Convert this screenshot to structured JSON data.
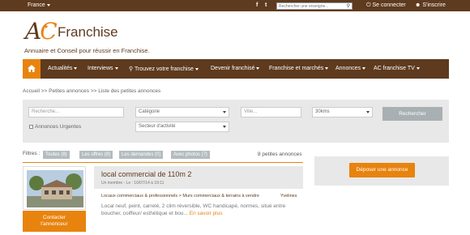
{
  "topbar": {
    "country": "France",
    "facebook_icon_label": "f",
    "twitter_icon_label": "t",
    "search_placeholder": "Rechercher une enseigne...",
    "login_label": "Se connecter",
    "register_label": "S'inscrire"
  },
  "brand": {
    "logo_ac_a": "A",
    "logo_ac_c": "C",
    "logo_text": "Franchise",
    "tagline": "Annuaire et Conseil pour réussir en Franchise."
  },
  "nav": {
    "items": [
      "Actualités",
      "Interviews",
      "Trouvez votre franchise",
      "Devenir franchisé",
      "Franchise et marchés",
      "Annonces",
      "AC franchise TV"
    ]
  },
  "breadcrumb": "Accueil >> Petites annonces >> Liste des petites annonces",
  "search": {
    "keyword_placeholder": "Recherche...",
    "category_value": "Catégorie",
    "city_placeholder": "Ville...",
    "distance_value": "30kms",
    "sector_value": "Secteur d'activité",
    "urgent_label": "Annonces Urgentes",
    "submit_label": "Rechercher"
  },
  "filters": {
    "label": "Filtres :",
    "pills": [
      "Toutes (8)",
      "Les offres (8)",
      "Les demandes (0)",
      "Avec photos (7)"
    ],
    "count": "8 petites annonces"
  },
  "sidebar": {
    "post_button": "Déposer une annonce"
  },
  "listing": {
    "title": "local commercial de 110m 2",
    "meta": "Un membre - Le : 16/07/14 à 19:11",
    "category": "Locaux commerciaux & professionnels > Murs commerciaux & terrains à vendre",
    "region": "Yvelines",
    "description": "Local neuf, peint, carrelé, 2 clim réversible, WC handicapé, normes, situé entre boucher, coiffeur/ esthétique et bou...",
    "more_link": "En savoir plus",
    "contact_line1": "Contacter",
    "contact_line2": "l'annonceur"
  },
  "colors": {
    "brand_brown": "#5e3a1e",
    "accent_orange": "#e8830e",
    "panel_gray": "#e8e8e8",
    "pill_gray": "#b4bcbf"
  }
}
